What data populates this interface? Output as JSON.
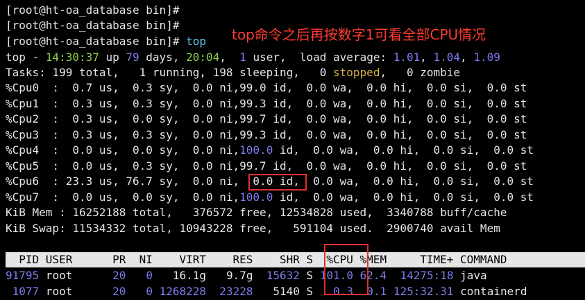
{
  "terminal": {
    "prompt_lines": [
      "[root@ht-oa_database bin]#",
      "[root@ht-oa_database bin]#",
      "[root@ht-oa_database bin]#"
    ],
    "command": "top"
  },
  "annotation": "top命令之后再按数字1可看全部CPU情况",
  "summary": {
    "l1_a": "top - ",
    "l1_time": "14:30:37",
    "l1_b": " up ",
    "l1_days": "79",
    "l1_c": " days, ",
    "l1_uptime": "20:04",
    "l1_d": ",  ",
    "l1_users": "1",
    "l1_e": " user,  load average: ",
    "l1_load1": "1.01",
    "l1_f": ", ",
    "l1_load5": "1.04",
    "l1_g": ", ",
    "l1_load15": "1.09",
    "tasks": "Tasks: 199 total,   1 running, 198 sleeping,   0 ",
    "stopped": "stopped",
    "tasks_end": ",   0 zombie"
  },
  "cpus": [
    {
      "pre": "%Cpu0  :  0.7 us,  0.3 sy,  0.0 ni,",
      "id": "99.0",
      "post": " id,  0.0 wa,  0.0 hi,  0.0 si,  0.0 st"
    },
    {
      "pre": "%Cpu1  :  0.3 us,  0.3 sy,  0.0 ni,",
      "id": "99.3",
      "post": " id,  0.0 wa,  0.0 hi,  0.0 si,  0.0 st"
    },
    {
      "pre": "%Cpu2  :  0.3 us,  0.0 sy,  0.0 ni,",
      "id": "99.7",
      "post": " id,  0.0 wa,  0.0 hi,  0.0 si,  0.0 st"
    },
    {
      "pre": "%Cpu3  :  0.3 us,  0.3 sy,  0.0 ni,",
      "id": "99.3",
      "post": " id,  0.0 wa,  0.0 hi,  0.0 si,  0.0 st"
    },
    {
      "pre": "%Cpu4  :  0.0 us,  0.0 sy,  0.0 ni,",
      "id": "100.0",
      "post": " id,  0.0 wa,  0.0 hi,  0.0 si,  0.0 st"
    },
    {
      "pre": "%Cpu5  :  0.0 us,  0.3 sy,  0.0 ni,",
      "id": "99.7",
      "post": " id,  0.0 wa,  0.0 hi,  0.0 si,  0.0 st"
    },
    {
      "pre": "%Cpu6  : 23.3 us, 76.7 sy,  0.0 ni,",
      "id": "0.0",
      "post": " id,  0.0 wa,  0.0 hi,  0.0 si,  0.0 st"
    },
    {
      "pre": "%Cpu7  :  0.0 us,  0.0 sy,  0.0 ni,",
      "id": "100.0",
      "post": " id,  0.0 wa,  0.0 hi,  0.0 si,  0.0 st"
    }
  ],
  "mem": "KiB Mem : 16252188 total,   376572 free, 12534828 used,  3340788 buff/cache",
  "swap": "KiB Swap: 11534332 total, 10943228 free,   591104 used.  2900740 avail Mem",
  "proc_header": "  PID USER      PR  NI    VIRT    RES    SHR S  %CPU %MEM     TIME+ COMMAND",
  "processes": [
    {
      "pid": "91795",
      "user": "root",
      "pr": "20",
      "ni": "0",
      "virt": "16.1g",
      "res": "9.7g",
      "shr": "15632",
      "s": "S",
      "cpu": "101.0",
      "mem": "62.4",
      "time": "14275:18",
      "cmd": "java"
    },
    {
      "pid": "1077",
      "user": "root",
      "pr": "20",
      "ni": "0",
      "virt": "1268228",
      "res": "23228",
      "shr": "5140",
      "s": "S",
      "cpu": "0.3",
      "mem": "0.1",
      "time": "125:32.31",
      "cmd": "containerd"
    }
  ],
  "colors": {
    "prompt": "#e05bd0",
    "command": "#5fc8e8",
    "value": "#7d7df0",
    "highlight_box": "#e0302a"
  }
}
